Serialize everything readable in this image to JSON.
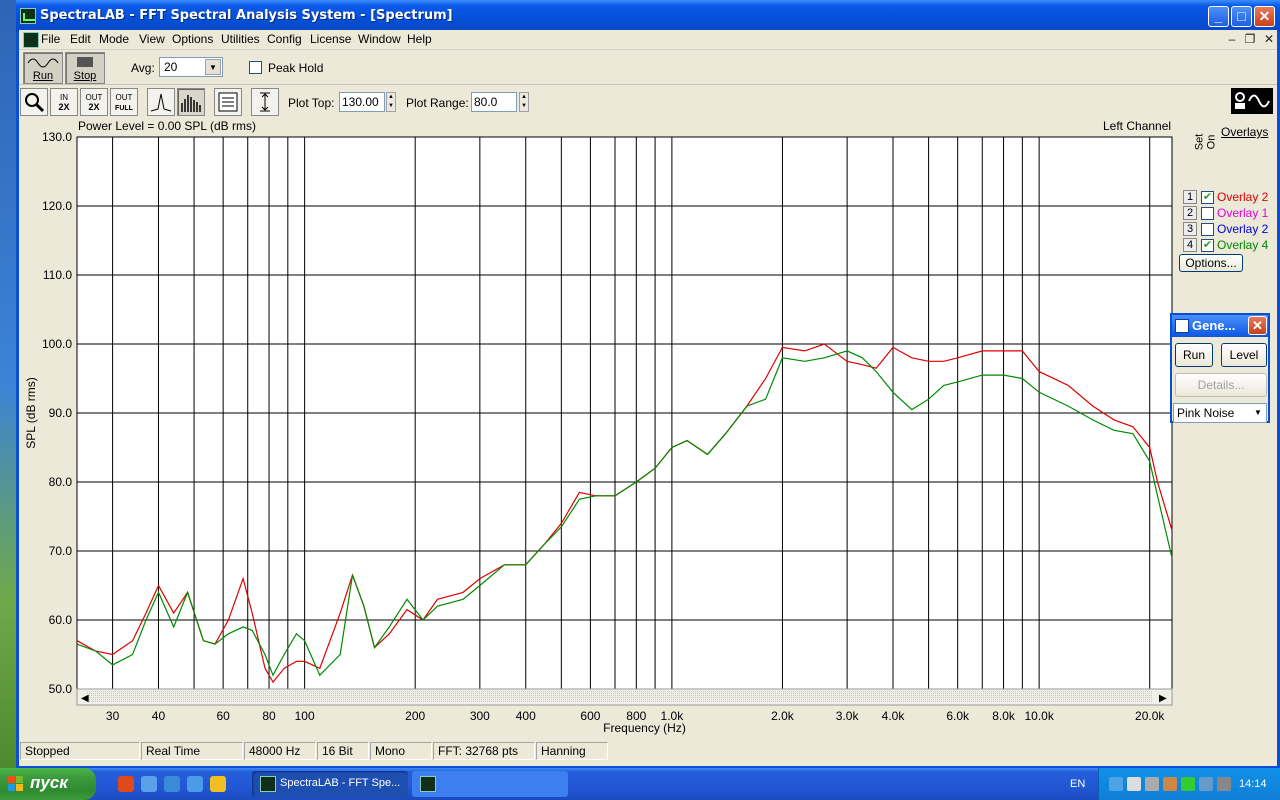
{
  "window": {
    "title": "SpectraLAB - FFT Spectral Analysis System - [Spectrum]",
    "controls": {
      "minimize": "_",
      "maximize": "□",
      "close": "✕"
    }
  },
  "menu": {
    "items": [
      "File",
      "Edit",
      "Mode",
      "View",
      "Options",
      "Utilities",
      "Config",
      "License",
      "Window",
      "Help"
    ],
    "mdi": {
      "minimize": "–",
      "restore": "❐",
      "close": "✕"
    }
  },
  "toolbar": {
    "run_label": "Run",
    "stop_label": "Stop",
    "avg_label": "Avg:",
    "avg_value": "20",
    "peak_hold_label": "Peak Hold",
    "zoom_in_top": "IN",
    "zoom_in_bottom": "2X",
    "zoom_out_top": "OUT",
    "zoom_out_bottom": "2X",
    "zoom_full_top": "OUT",
    "zoom_full_bottom": "FULL",
    "plot_top_label": "Plot Top:",
    "plot_top_value": "130.00",
    "plot_range_label": "Plot Range:",
    "plot_range_value": "80.0"
  },
  "chart_header": {
    "power_level": "Power Level = 0.00 SPL (dB rms)",
    "channel": "Left Channel"
  },
  "chart_data": {
    "type": "line",
    "xlabel": "Frequency (Hz)",
    "ylabel": "SPL (dB rms)",
    "x_scale": "log",
    "xlim": [
      24,
      23000
    ],
    "ylim": [
      50,
      130
    ],
    "y_ticks": [
      "130.0",
      "120.0",
      "110.0",
      "100.0",
      "90.0",
      "80.0",
      "70.0",
      "60.0",
      "50.0"
    ],
    "x_ticks": [
      {
        "value": 30,
        "label": "30"
      },
      {
        "value": 40,
        "label": "40"
      },
      {
        "value": 60,
        "label": "60"
      },
      {
        "value": 80,
        "label": "80"
      },
      {
        "value": 100,
        "label": "100"
      },
      {
        "value": 200,
        "label": "200"
      },
      {
        "value": 300,
        "label": "300"
      },
      {
        "value": 400,
        "label": "400"
      },
      {
        "value": 600,
        "label": "600"
      },
      {
        "value": 800,
        "label": "800"
      },
      {
        "value": 1000,
        "label": "1.0k"
      },
      {
        "value": 2000,
        "label": "2.0k"
      },
      {
        "value": 3000,
        "label": "3.0k"
      },
      {
        "value": 4000,
        "label": "4.0k"
      },
      {
        "value": 6000,
        "label": "6.0k"
      },
      {
        "value": 8000,
        "label": "8.0k"
      },
      {
        "value": 10000,
        "label": "10.0k"
      },
      {
        "value": 20000,
        "label": "20.0k"
      }
    ],
    "grid_freqs": [
      30,
      40,
      50,
      60,
      70,
      80,
      90,
      100,
      200,
      300,
      400,
      500,
      600,
      700,
      800,
      900,
      1000,
      2000,
      3000,
      4000,
      5000,
      6000,
      7000,
      8000,
      9000,
      10000,
      20000
    ],
    "grid": true,
    "series": [
      {
        "name": "Overlay 2",
        "color": "#e00000",
        "points": [
          [
            24,
            57
          ],
          [
            27,
            55.5
          ],
          [
            30,
            55
          ],
          [
            34,
            57
          ],
          [
            37,
            61
          ],
          [
            40,
            65
          ],
          [
            44,
            61
          ],
          [
            48,
            64
          ],
          [
            53,
            57
          ],
          [
            57,
            56.5
          ],
          [
            62,
            60
          ],
          [
            68,
            66
          ],
          [
            72,
            61
          ],
          [
            78,
            53
          ],
          [
            82,
            51
          ],
          [
            88,
            53
          ],
          [
            95,
            54
          ],
          [
            100,
            54
          ],
          [
            110,
            53
          ],
          [
            125,
            61
          ],
          [
            135,
            66.5
          ],
          [
            145,
            62
          ],
          [
            155,
            56
          ],
          [
            170,
            58
          ],
          [
            190,
            61.5
          ],
          [
            210,
            60
          ],
          [
            230,
            63
          ],
          [
            270,
            64
          ],
          [
            300,
            66
          ],
          [
            350,
            68
          ],
          [
            400,
            68
          ],
          [
            450,
            71
          ],
          [
            500,
            74
          ],
          [
            560,
            78.5
          ],
          [
            620,
            78
          ],
          [
            700,
            78
          ],
          [
            800,
            80
          ],
          [
            900,
            82
          ],
          [
            1000,
            85
          ],
          [
            1100,
            86
          ],
          [
            1250,
            84
          ],
          [
            1400,
            87
          ],
          [
            1600,
            91
          ],
          [
            1800,
            95
          ],
          [
            2000,
            99.5
          ],
          [
            2300,
            99
          ],
          [
            2600,
            100
          ],
          [
            3000,
            97.5
          ],
          [
            3300,
            97
          ],
          [
            3600,
            96.5
          ],
          [
            4000,
            99.5
          ],
          [
            4500,
            98
          ],
          [
            5000,
            97.5
          ],
          [
            5500,
            97.5
          ],
          [
            6000,
            98
          ],
          [
            7000,
            99
          ],
          [
            8000,
            99
          ],
          [
            9000,
            99
          ],
          [
            10000,
            96
          ],
          [
            12000,
            94
          ],
          [
            14000,
            91
          ],
          [
            16000,
            89
          ],
          [
            18000,
            88
          ],
          [
            20000,
            85
          ],
          [
            21000,
            80
          ],
          [
            23000,
            73
          ]
        ]
      },
      {
        "name": "Overlay 4",
        "color": "#008a00",
        "points": [
          [
            24,
            56.5
          ],
          [
            27,
            55.5
          ],
          [
            30,
            53.5
          ],
          [
            34,
            55
          ],
          [
            37,
            60
          ],
          [
            40,
            64
          ],
          [
            44,
            59
          ],
          [
            48,
            64
          ],
          [
            53,
            57
          ],
          [
            57,
            56.5
          ],
          [
            62,
            58
          ],
          [
            68,
            59
          ],
          [
            72,
            58.5
          ],
          [
            78,
            55
          ],
          [
            82,
            52
          ],
          [
            88,
            55
          ],
          [
            95,
            58
          ],
          [
            100,
            57
          ],
          [
            110,
            52
          ],
          [
            125,
            55
          ],
          [
            135,
            66.5
          ],
          [
            145,
            62
          ],
          [
            155,
            56
          ],
          [
            170,
            59
          ],
          [
            190,
            63
          ],
          [
            210,
            60
          ],
          [
            230,
            62
          ],
          [
            270,
            63
          ],
          [
            300,
            65
          ],
          [
            350,
            68
          ],
          [
            400,
            68
          ],
          [
            450,
            71
          ],
          [
            500,
            73.5
          ],
          [
            560,
            77.5
          ],
          [
            620,
            78
          ],
          [
            700,
            78
          ],
          [
            800,
            80
          ],
          [
            900,
            82
          ],
          [
            1000,
            85
          ],
          [
            1100,
            86
          ],
          [
            1250,
            84
          ],
          [
            1400,
            87
          ],
          [
            1600,
            91
          ],
          [
            1800,
            92
          ],
          [
            2000,
            98
          ],
          [
            2300,
            97.5
          ],
          [
            2600,
            98
          ],
          [
            3000,
            99
          ],
          [
            3300,
            98
          ],
          [
            3600,
            96
          ],
          [
            4000,
            93
          ],
          [
            4500,
            90.5
          ],
          [
            5000,
            92
          ],
          [
            5500,
            94
          ],
          [
            6000,
            94.5
          ],
          [
            7000,
            95.5
          ],
          [
            8000,
            95.5
          ],
          [
            9000,
            95
          ],
          [
            10000,
            93
          ],
          [
            12000,
            91
          ],
          [
            14000,
            89
          ],
          [
            16000,
            87.5
          ],
          [
            18000,
            87
          ],
          [
            20000,
            83
          ],
          [
            21000,
            78
          ],
          [
            23000,
            69
          ]
        ]
      }
    ]
  },
  "overlays": {
    "title": "Overlays",
    "col_set": "Set",
    "col_on": "On",
    "rows": [
      {
        "num": "1",
        "checked": true,
        "name": "Overlay 2",
        "color": "#e00000"
      },
      {
        "num": "2",
        "checked": false,
        "name": "Overlay 1",
        "color": "#e000e0"
      },
      {
        "num": "3",
        "checked": false,
        "name": "Overlay 2",
        "color": "#0000e0"
      },
      {
        "num": "4",
        "checked": true,
        "name": "Overlay 4",
        "color": "#008a00"
      }
    ],
    "options_label": "Options..."
  },
  "generator": {
    "title": "Gene...",
    "run_label": "Run",
    "level_label": "Level",
    "details_label": "Details...",
    "signal": "Pink Noise"
  },
  "statusbar": {
    "cells": [
      "Stopped",
      "Real Time",
      "48000 Hz",
      "16 Bit",
      "Mono",
      "FFT: 32768 pts",
      "Hanning"
    ]
  },
  "taskbar": {
    "start_label": "пуск",
    "task_label": "SpectraLAB - FFT Spe...",
    "lang": "EN",
    "clock": "14:14"
  }
}
